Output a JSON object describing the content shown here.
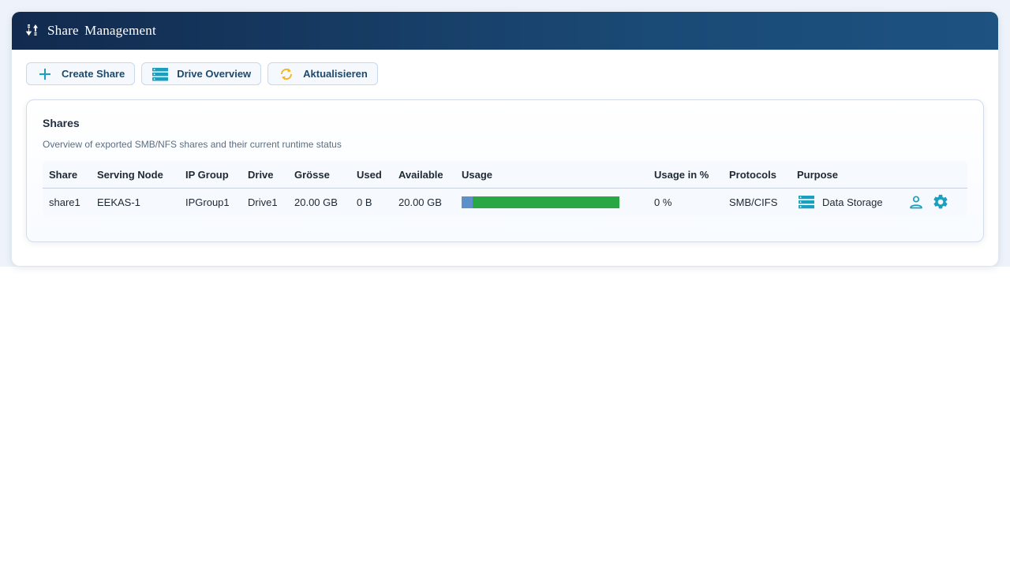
{
  "header": {
    "title": "Share  Management",
    "icon": "sort-arrows-icon"
  },
  "toolbar": {
    "create_label": "Create Share",
    "drive_label": "Drive Overview",
    "refresh_label": "Aktualisieren"
  },
  "card": {
    "title": "Shares",
    "subtitle": "Overview of exported SMB/NFS shares and their current runtime status"
  },
  "table": {
    "columns": [
      "Share",
      "Serving Node",
      "IP Group",
      "Drive",
      "Grösse",
      "Used",
      "Available",
      "Usage",
      "Usage in %",
      "Protocols",
      "Purpose"
    ],
    "rows": [
      {
        "share": "share1",
        "node": "EEKAS-1",
        "ip_group": "IPGroup1",
        "drive": "Drive1",
        "size": "20.00 GB",
        "used": "0 B",
        "available": "20.00 GB",
        "usage_fraction": 0.07,
        "usage_pct": "0 %",
        "protocols": "SMB/CIFS",
        "purpose": "Data Storage"
      }
    ]
  },
  "colors": {
    "accent": "#1a9fbf",
    "header_dark": "#122a4e",
    "refresh": "#f2b824",
    "usage_free": "#2aa745",
    "usage_used": "#5d8fcb"
  }
}
